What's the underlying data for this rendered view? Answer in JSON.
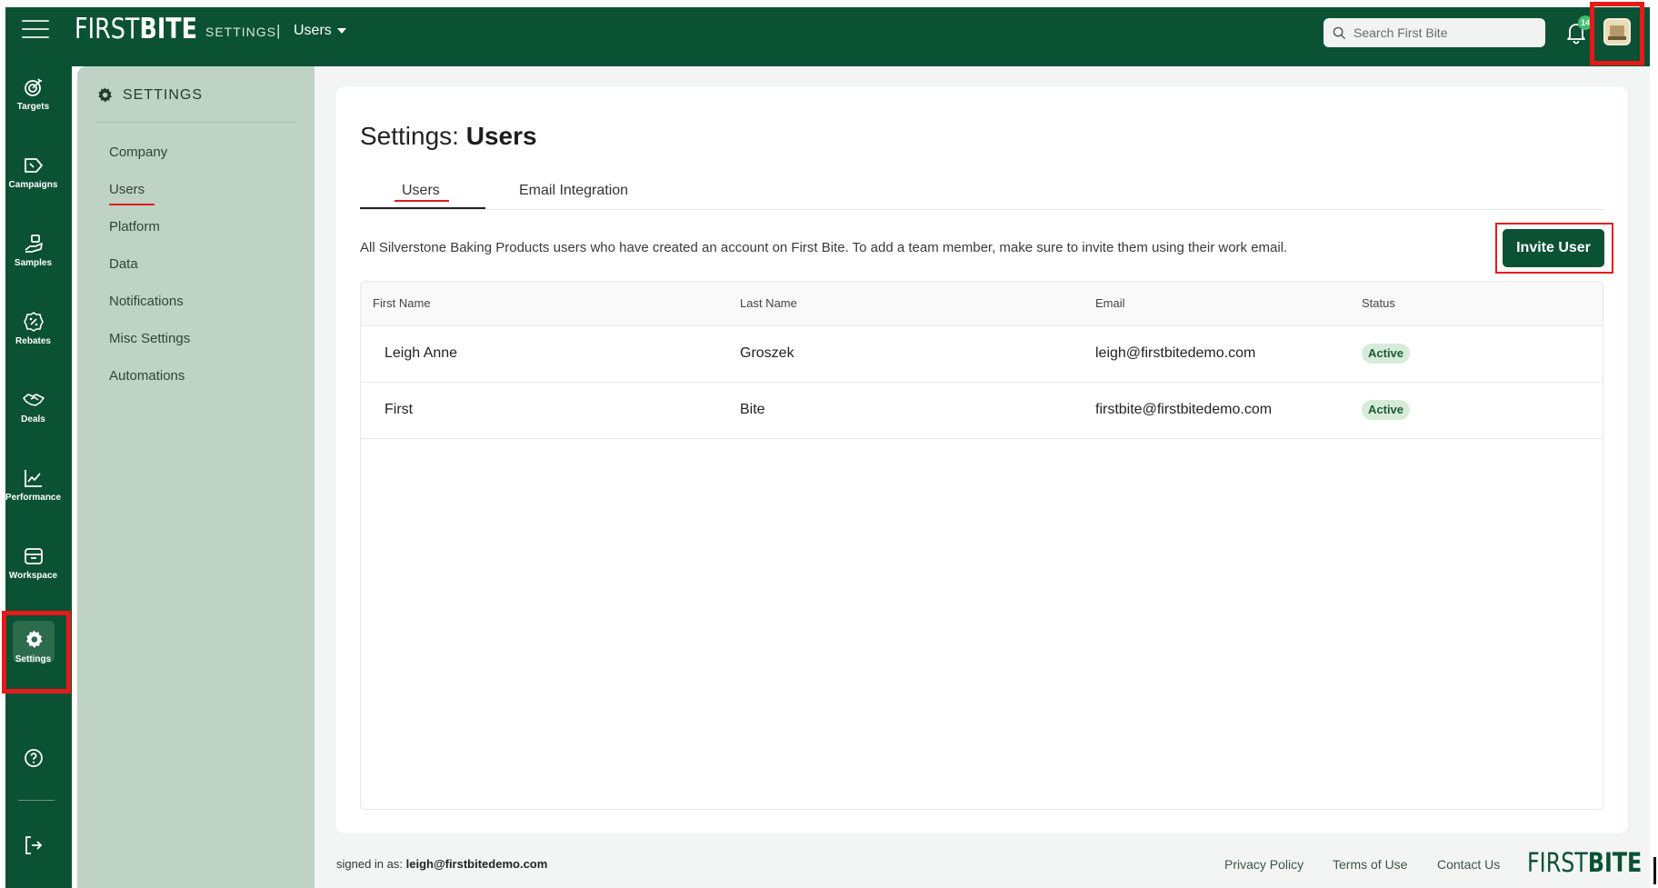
{
  "header": {
    "brand_light": "FIRST",
    "brand_bold": "BITE",
    "section": "SETTINGS",
    "separator": "|",
    "page_switcher": "Users",
    "search_placeholder": "Search First Bite",
    "notification_count": "14"
  },
  "rail": {
    "items": [
      {
        "label": "Targets",
        "icon": "target-icon"
      },
      {
        "label": "Campaigns",
        "icon": "megaphone-icon"
      },
      {
        "label": "Samples",
        "icon": "hand-package-icon"
      },
      {
        "label": "Rebates",
        "icon": "percent-badge-icon"
      },
      {
        "label": "Deals",
        "icon": "handshake-icon"
      },
      {
        "label": "Performance",
        "icon": "line-chart-icon"
      },
      {
        "label": "Workspace",
        "icon": "archive-box-icon"
      },
      {
        "label": "Settings",
        "icon": "gear-icon"
      }
    ],
    "help_icon": "help-circle-icon",
    "logout_icon": "logout-icon"
  },
  "sidebar": {
    "title": "SETTINGS",
    "items": [
      {
        "label": "Company"
      },
      {
        "label": "Users"
      },
      {
        "label": "Platform"
      },
      {
        "label": "Data"
      },
      {
        "label": "Notifications"
      },
      {
        "label": "Misc Settings"
      },
      {
        "label": "Automations"
      }
    ]
  },
  "main": {
    "title_prefix": "Settings: ",
    "title_bold": "Users",
    "tabs": [
      {
        "label": "Users"
      },
      {
        "label": "Email Integration"
      }
    ],
    "description": "All Silverstone Baking Products users who have created an account on First Bite. To add a team member, make sure to invite them using their work email.",
    "invite_button": "Invite User",
    "table": {
      "columns": [
        "First Name",
        "Last Name",
        "Email",
        "Status"
      ],
      "rows": [
        {
          "first": "Leigh Anne",
          "last": "Groszek",
          "email": "leigh@firstbitedemo.com",
          "status": "Active"
        },
        {
          "first": "First",
          "last": "Bite",
          "email": "firstbite@firstbitedemo.com",
          "status": "Active"
        }
      ]
    }
  },
  "footer": {
    "signed_in_label": "signed in as: ",
    "signed_in_email": "leigh@firstbitedemo.com",
    "links": [
      "Privacy Policy",
      "Terms of Use",
      "Contact Us"
    ],
    "brand_light": "FIRST",
    "brand_bold": "BITE"
  },
  "colors": {
    "brand_green": "#0b5133",
    "sidebar_bg": "#bfd3c5",
    "active_badge_bg": "#d6ecd9",
    "highlight_red": "#e51a1a"
  }
}
